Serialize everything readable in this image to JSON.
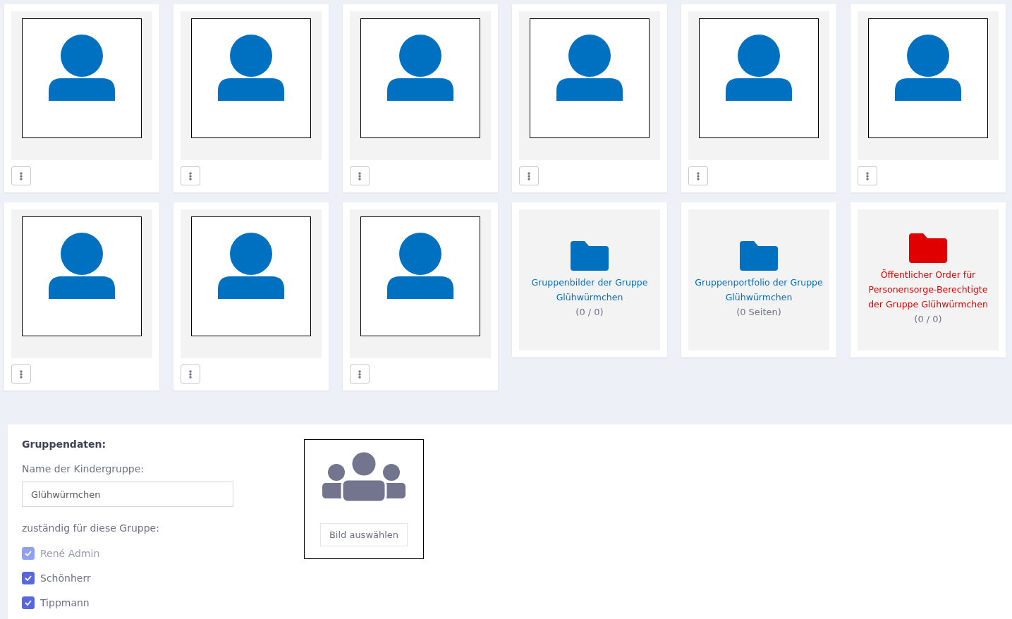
{
  "tiles": [
    {
      "kind": "person"
    },
    {
      "kind": "person"
    },
    {
      "kind": "person"
    },
    {
      "kind": "person"
    },
    {
      "kind": "person"
    },
    {
      "kind": "person"
    },
    {
      "kind": "person"
    },
    {
      "kind": "person"
    },
    {
      "kind": "person"
    },
    {
      "kind": "folder",
      "title": "Gruppenbilder der Gruppe Glühwürmchen",
      "count": "(0 / 0)",
      "color": "#0070c0"
    },
    {
      "kind": "folder",
      "title": "Gruppenportfolio der Gruppe Glühwürmchen",
      "count": "(0 Seiten)",
      "color": "#0070c0"
    },
    {
      "kind": "folder",
      "title": "Öffentlicher Order für Personensorge-Berechtigte der Gruppe Glühwürmchen",
      "count": "(0 / 0)",
      "color": "#e00000"
    }
  ],
  "group_data": {
    "heading": "Gruppendaten:",
    "name_label": "Name der Kindergruppe:",
    "name_value": "Glühwürmchen",
    "responsible_label": "zuständig für diese Gruppe:",
    "responsible": [
      {
        "name": "René Admin",
        "checked": true,
        "disabled": true
      },
      {
        "name": "Schönherr",
        "checked": true,
        "disabled": false
      },
      {
        "name": "Tippmann",
        "checked": true,
        "disabled": false
      }
    ],
    "image_button": "Bild auswählen"
  }
}
